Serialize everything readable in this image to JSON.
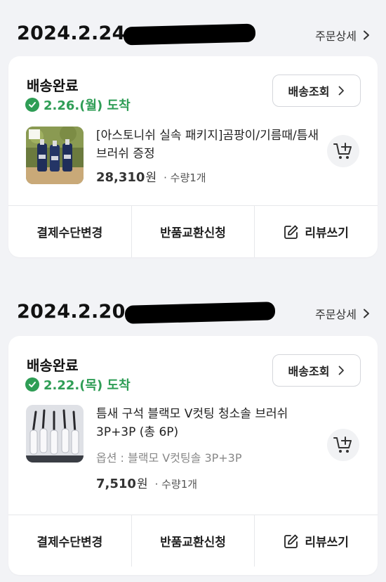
{
  "orders": [
    {
      "date": "2024.2.24",
      "detail_link": "주문상세",
      "status": "배송완료",
      "arrival": "2.26.(월) 도착",
      "track_button": "배송조회",
      "product_name": "[아스토니쉬 실속 패키지]곰팡이/기름때/틈새브러쉬 증정",
      "option": "",
      "price": "28,310",
      "currency": "원",
      "quantity": "· 수량1개",
      "actions": [
        "결제수단변경",
        "반품교환신청",
        "리뷰쓰기"
      ]
    },
    {
      "date": "2024.2.20",
      "detail_link": "주문상세",
      "status": "배송완료",
      "arrival": "2.22.(목) 도착",
      "track_button": "배송조회",
      "product_name": "틈새 구석 블랙모 V컷팅 청소솔 브러쉬 3P+3P (총 6P)",
      "option": "옵션 : 블랙모 V컷팅솔 3P+3P",
      "price": "7,510",
      "currency": "원",
      "quantity": "· 수량1개",
      "actions": [
        "결제수단변경",
        "반품교환신청",
        "리뷰쓰기"
      ]
    }
  ],
  "colors": {
    "background": "#f2f3f6",
    "card": "#ffffff",
    "delivered_green": "#2e9d55",
    "redaction": "#000000"
  },
  "icons": [
    "chevron-right-icon",
    "check-circle-icon",
    "cart-plus-icon",
    "edit-icon"
  ]
}
